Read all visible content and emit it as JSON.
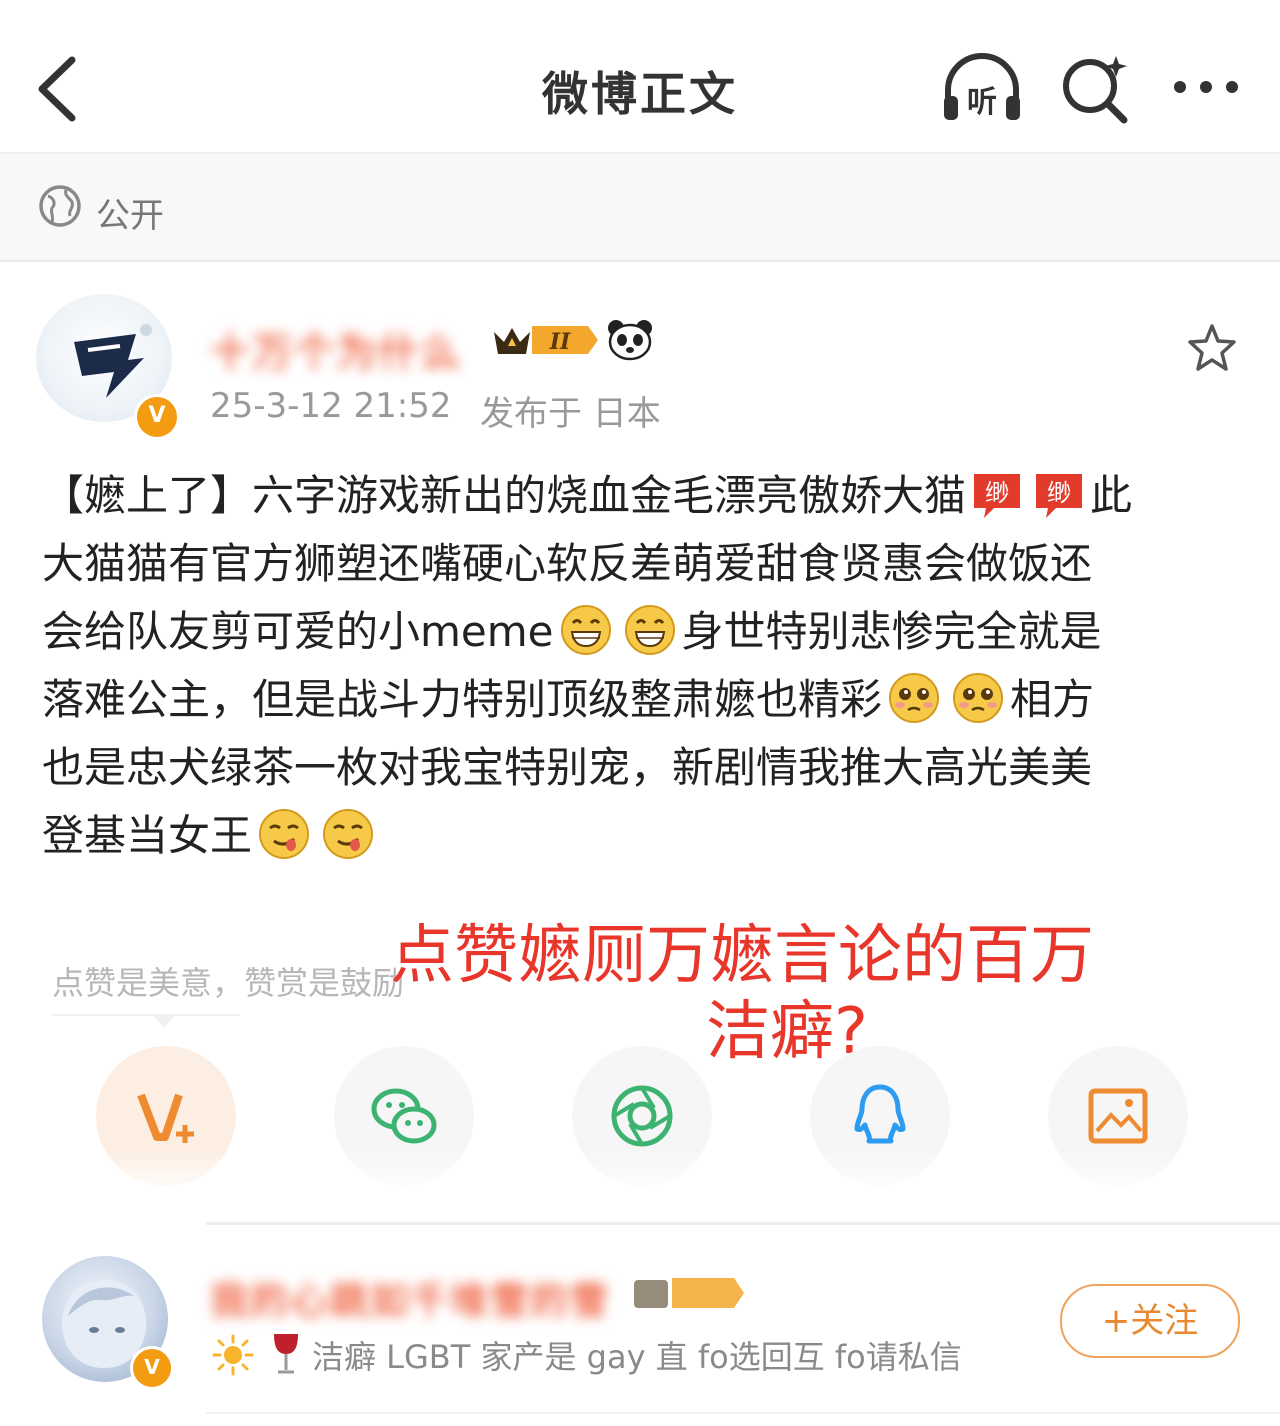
{
  "header": {
    "title": "微博正文",
    "listen_icon_text": "听"
  },
  "visibility": {
    "label": "公开"
  },
  "post": {
    "author_name": "十万个为什么",
    "vip_level": "II",
    "timestamp": "25-3-12 21:52",
    "location": "发布于 日本",
    "bubble_emoji_text": "缈",
    "body": {
      "line1_a": "【嬷上了】六字游戏新出的烧血金毛漂亮傲娇大猫",
      "line1_b": "此",
      "line2": "大猫猫有官方狮塑还嘴硬心软反差萌爱甜食贤惠会做饭还",
      "line3_a": "会给队友剪可爱的小meme",
      "line3_b": "身世特别悲惨完全就是",
      "line4_a": "落难公主，但是战斗力特别顶级整肃嬷也精彩",
      "line4_b": "相方",
      "line5": "也是忠犬绿茶一枚对我宝特别宠，新剧情我推大高光美美",
      "line6": "登基当女王"
    },
    "reward_hint": "点赞是美意，赞赏是鼓励"
  },
  "overlay": {
    "line1": "点赞嬷厕万嬷言论的百万",
    "line2": "洁癖?"
  },
  "share_icons": [
    "v-plus-icon",
    "wechat-icon",
    "moments-icon",
    "qq-icon",
    "image-icon"
  ],
  "commenter": {
    "name": "我的心跳如千堆雪的雪",
    "bio": "洁癖 LGBT 家产是 gay 直 fo选回互 fo请私信",
    "follow_label": "+关注"
  },
  "colors": {
    "accent_orange": "#f39c12",
    "overlay_red": "#e8362a",
    "name_blur_color": "#f06a4a"
  }
}
